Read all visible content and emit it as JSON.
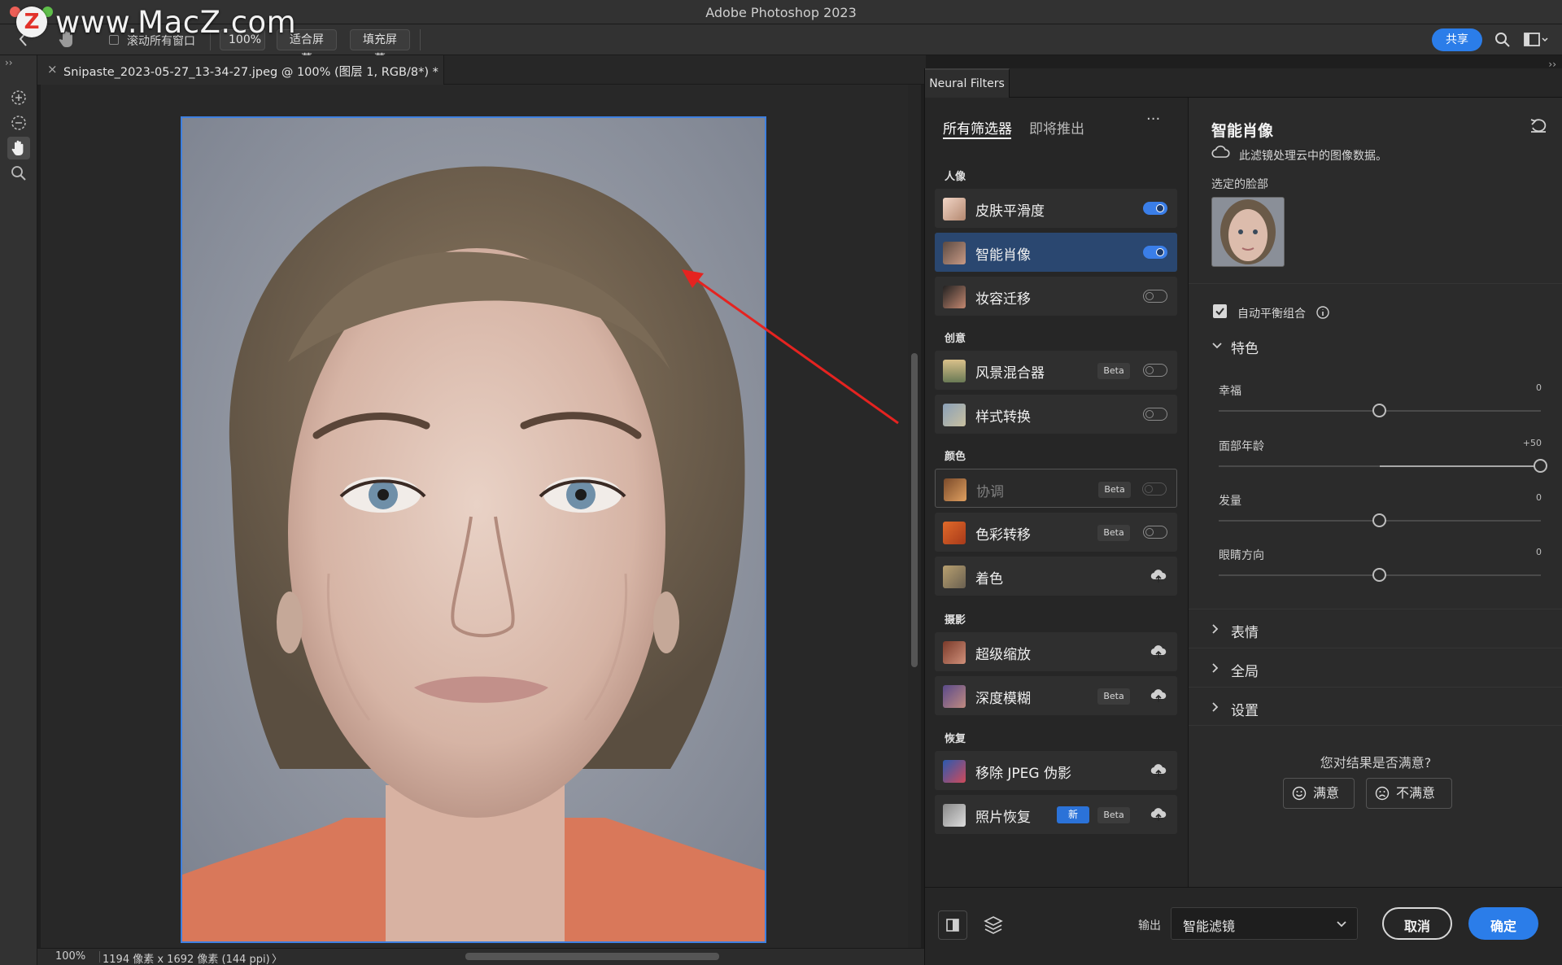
{
  "window": {
    "title": "Adobe Photoshop 2023"
  },
  "watermark": {
    "logo_letter": "Z",
    "text": "www.MacZ.com"
  },
  "options_bar": {
    "scroll_all_windows": "滚动所有窗口",
    "zoom": "100%",
    "fit_screen": "适合屏幕",
    "fill_screen": "填充屏幕",
    "share": "共享"
  },
  "document": {
    "tab_close": "×",
    "tab_title": "Snipaste_2023-05-27_13-34-27.jpeg @ 100% (图层 1, RGB/8*) *",
    "status_zoom": "100%",
    "status_info": "1194 像素 x 1692 像素 (144 ppi)",
    "status_arrow": "〉"
  },
  "neural_filters": {
    "panel_tab": "Neural Filters",
    "list_tabs": {
      "all": "所有筛选器",
      "upcoming": "即将推出",
      "more": "···"
    },
    "badges": {
      "beta": "Beta",
      "new": "新"
    },
    "sections": [
      {
        "label": "人像",
        "filters": [
          {
            "name": "皮肤平滑度",
            "state": "on"
          },
          {
            "name": "智能肖像",
            "state": "on",
            "selected": true
          },
          {
            "name": "妆容迁移",
            "state": "off"
          }
        ]
      },
      {
        "label": "创意",
        "filters": [
          {
            "name": "风景混合器",
            "state": "off",
            "beta": true
          },
          {
            "name": "样式转换",
            "state": "off"
          }
        ]
      },
      {
        "label": "颜色",
        "filters": [
          {
            "name": "协调",
            "state": "off",
            "beta": true,
            "dim": true
          },
          {
            "name": "色彩转移",
            "state": "off",
            "beta": true
          },
          {
            "name": "着色",
            "state": "cloud"
          }
        ]
      },
      {
        "label": "摄影",
        "filters": [
          {
            "name": "超级缩放",
            "state": "cloud"
          },
          {
            "name": "深度模糊",
            "state": "cloud",
            "beta": true
          }
        ]
      },
      {
        "label": "恢复",
        "filters": [
          {
            "name": "移除 JPEG 伪影",
            "state": "cloud"
          },
          {
            "name": "照片恢复",
            "state": "cloud",
            "beta": true,
            "new": true
          }
        ]
      }
    ],
    "settings": {
      "title": "智能肖像",
      "cloud_note": "此滤镜处理云中的图像数据。",
      "selected_face_label": "选定的脸部",
      "auto_balance": "自动平衡组合",
      "featured_section": "特色",
      "sliders": [
        {
          "label": "幸福",
          "value": "0",
          "position": 0.5
        },
        {
          "label": "面部年龄",
          "value": "+50",
          "position": 1.0
        },
        {
          "label": "发量",
          "value": "0",
          "position": 0.5
        },
        {
          "label": "眼睛方向",
          "value": "0",
          "position": 0.5
        }
      ],
      "collapsed_sections": [
        "表情",
        "全局",
        "设置"
      ],
      "feedback_question": "您对结果是否满意?",
      "satisfied": "满意",
      "unsatisfied": "不满意"
    },
    "footer": {
      "output_label": "输出",
      "output_value": "智能滤镜",
      "cancel": "取消",
      "ok": "确定"
    }
  },
  "colors": {
    "accent": "#2b7de9",
    "selection": "#2a4770",
    "arrow": "#e52320"
  }
}
